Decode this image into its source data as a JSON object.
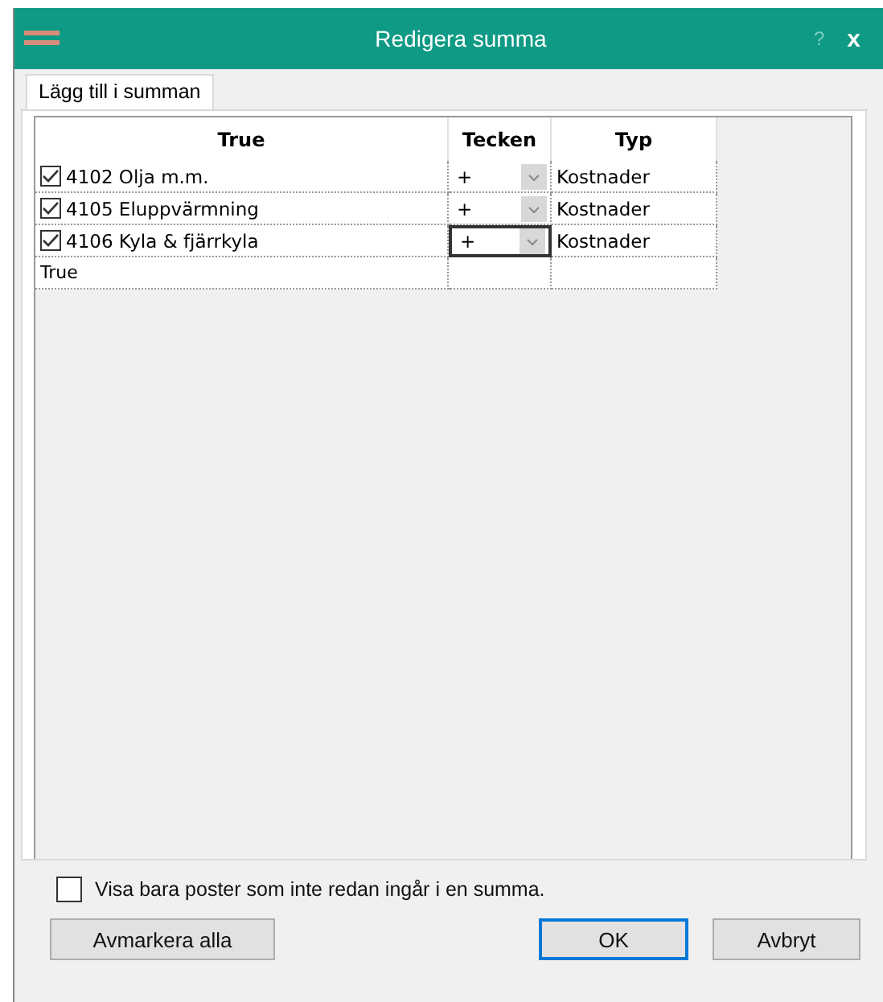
{
  "window": {
    "title": "Redigera summa",
    "help": "?",
    "close": "x"
  },
  "tabs": [
    {
      "label": "Lägg till i summan",
      "selected": true
    }
  ],
  "table": {
    "columns": [
      "True",
      "Tecken",
      "Typ"
    ],
    "rows": [
      {
        "checked": true,
        "name": "4102 Olja m.m.",
        "sign": "+",
        "focused": false,
        "type": "Kostnader"
      },
      {
        "checked": true,
        "name": "4105 Eluppvärmning",
        "sign": "+",
        "focused": false,
        "type": "Kostnader"
      },
      {
        "checked": true,
        "name": "4106 Kyla & fjärrkyla",
        "sign": "+",
        "focused": true,
        "type": "Kostnader"
      }
    ],
    "new_row": "True"
  },
  "filter": {
    "label": "Visa bara poster som inte redan ingår i en summa.",
    "checked": false
  },
  "buttons": [
    {
      "label": "Avmarkera alla",
      "default": false
    },
    {
      "label": "OK",
      "default": true
    },
    {
      "label": "Avbryt",
      "default": false
    }
  ]
}
